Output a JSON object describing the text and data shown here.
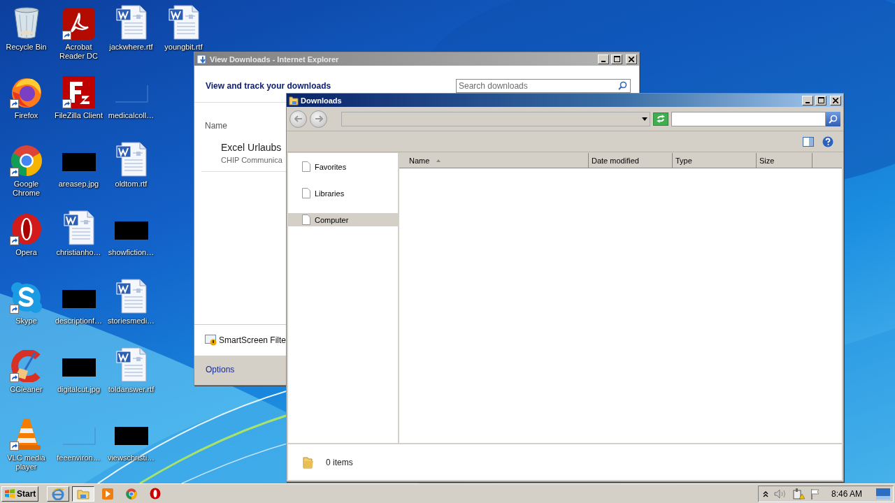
{
  "desktop_icons": [
    {
      "label": "Recycle Bin",
      "kind": "recycle",
      "shortcut": false
    },
    {
      "label": "Firefox",
      "kind": "firefox",
      "shortcut": true
    },
    {
      "label": "Google Chrome",
      "kind": "chrome",
      "shortcut": true
    },
    {
      "label": "Opera",
      "kind": "opera",
      "shortcut": true
    },
    {
      "label": "Skype",
      "kind": "skype",
      "shortcut": true
    },
    {
      "label": "CCleaner",
      "kind": "ccleaner",
      "shortcut": true
    },
    {
      "label": "VLC media player",
      "kind": "vlc",
      "shortcut": true
    },
    {
      "label": "Acrobat Reader DC",
      "kind": "pdf",
      "shortcut": true
    },
    {
      "label": "FileZilla Client",
      "kind": "filezilla",
      "shortcut": true
    },
    {
      "label": "areasep.jpg",
      "kind": "dark-image",
      "shortcut": false
    },
    {
      "label": "christianho…",
      "kind": "word",
      "shortcut": false
    },
    {
      "label": "descriptionf…",
      "kind": "dark-image",
      "shortcut": false
    },
    {
      "label": "digitalcut.jpg",
      "kind": "dark-image",
      "shortcut": false
    },
    {
      "label": "feeenviron…",
      "kind": "blank",
      "shortcut": false
    },
    {
      "label": "jackwhere.rtf",
      "kind": "word",
      "shortcut": false
    },
    {
      "label": "medicalcoll…",
      "kind": "blank",
      "shortcut": false
    },
    {
      "label": "oldtom.rtf",
      "kind": "word",
      "shortcut": false
    },
    {
      "label": "showfiction…",
      "kind": "dark-image",
      "shortcut": false
    },
    {
      "label": "storiesmedi…",
      "kind": "word",
      "shortcut": false
    },
    {
      "label": "toldanswer.rtf",
      "kind": "word",
      "shortcut": false
    },
    {
      "label": "viewschristi…",
      "kind": "dark-image",
      "shortcut": false
    },
    {
      "label": "youngbit.rtf",
      "kind": "word",
      "shortcut": false
    }
  ],
  "ie_window": {
    "title": "View Downloads - Internet Explorer",
    "heading": "View and track your downloads",
    "search": {
      "placeholder": "Search downloads"
    },
    "column": "Name",
    "download": {
      "name": "Excel Urlaubs",
      "publisher": "CHIP Communica"
    },
    "smartscreen": "SmartScreen Filte",
    "options": "Options"
  },
  "explorer_window": {
    "title": "Downloads",
    "nav_items": [
      {
        "label": "Favorites",
        "selected": false
      },
      {
        "label": "Libraries",
        "selected": false
      },
      {
        "label": "Computer",
        "selected": true
      }
    ],
    "columns": [
      {
        "label": "Name",
        "sorted": true
      },
      {
        "label": "Date modified",
        "sorted": false
      },
      {
        "label": "Type",
        "sorted": false
      },
      {
        "label": "Size",
        "sorted": false
      }
    ],
    "status": "0 items"
  },
  "taskbar": {
    "start": "Start",
    "apps": [
      {
        "kind": "ie",
        "selected": false
      },
      {
        "kind": "explorer",
        "selected": true
      },
      {
        "kind": "media",
        "selected": false
      },
      {
        "kind": "chrome",
        "selected": false
      },
      {
        "kind": "opera",
        "selected": false
      }
    ],
    "clock": "8:46 AM"
  }
}
